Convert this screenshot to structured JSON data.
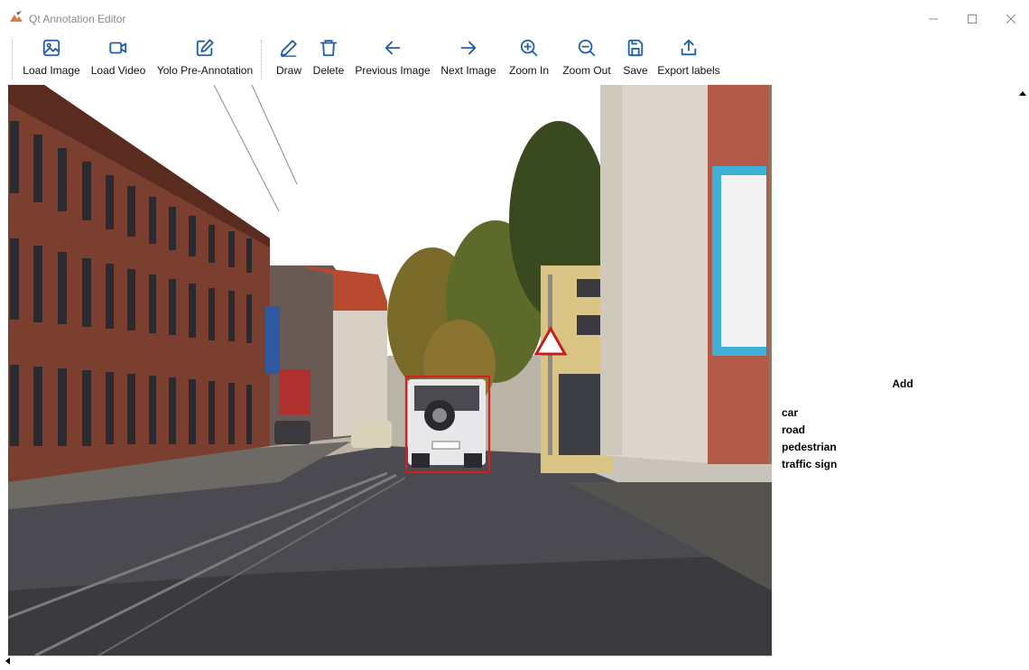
{
  "window": {
    "title": "Qt Annotation Editor"
  },
  "toolbar": {
    "load_image": "Load Image",
    "load_video": "Load Video",
    "yolo": "Yolo Pre-Annotation",
    "draw": "Draw",
    "delete": "Delete",
    "previous": "Previous Image",
    "next": "Next Image",
    "zoom_in": "Zoom In",
    "zoom_out": "Zoom Out",
    "save": "Save",
    "export": "Export labels"
  },
  "panel": {
    "add_title": "Add",
    "labels": [
      "car",
      "road",
      "pedestrian",
      "traffic sign"
    ]
  },
  "colors": {
    "accent": "#1f5ea8",
    "annotation_box": "#d21f1f"
  },
  "icons": [
    "image-icon",
    "video-icon",
    "edit-icon",
    "pencil-icon",
    "trash-icon",
    "arrow-left-icon",
    "arrow-right-icon",
    "zoom-in-icon",
    "zoom-out-icon",
    "save-icon",
    "export-icon"
  ]
}
